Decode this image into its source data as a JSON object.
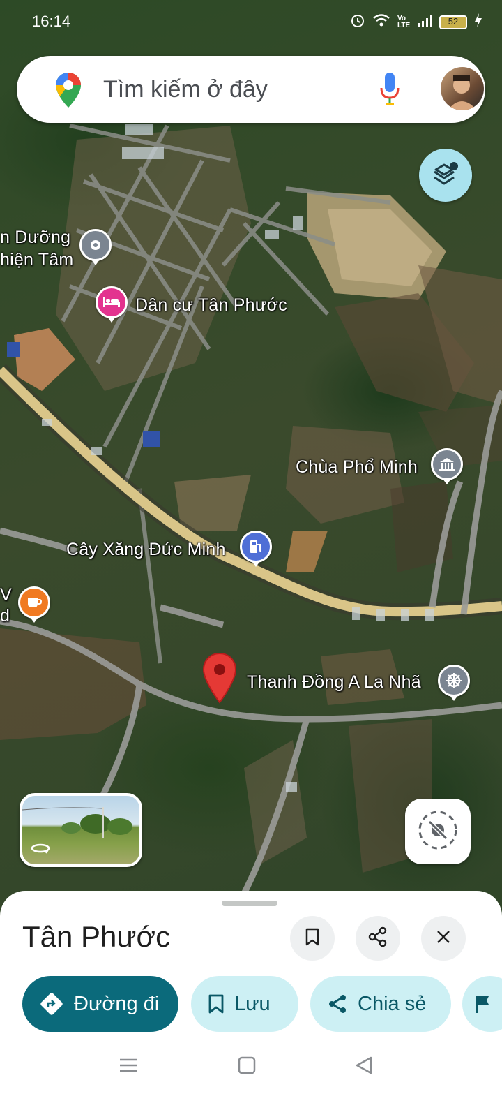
{
  "status_bar": {
    "time": "16:14",
    "battery": "52",
    "network_badge": "Vo LTE"
  },
  "search": {
    "placeholder": "Tìm kiếm ở đây"
  },
  "map_labels": {
    "top_left_line1": "n Dưỡng",
    "top_left_line2": "hiện Tâm",
    "dan_cu": "Dân cư Tân Phước",
    "chua": "Chùa Phổ Minh",
    "cay_xang": "Cây Xăng Đức Minh",
    "left_v": "V",
    "left_d": "d",
    "thanh_dong": "Thanh Đồng A La Nhã"
  },
  "sheet": {
    "title": "Tân Phước",
    "directions_label": "Đường đi",
    "save_label": "Lưu",
    "share_label": "Chia sẻ"
  },
  "colors": {
    "accent": "#0b6a7b",
    "chip_secondary": "#cdf0f4",
    "pin_red": "#e53935",
    "pin_pink": "#e3338f",
    "pin_blue": "#4f6fd6",
    "pin_gray": "#7b8591",
    "pin_orange": "#f07a22"
  }
}
